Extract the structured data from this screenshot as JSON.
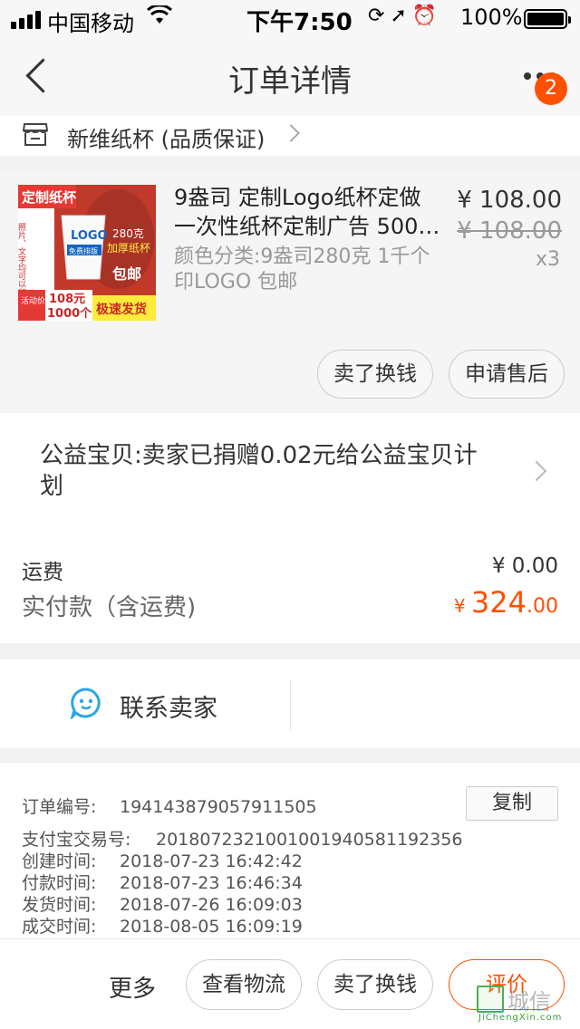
{
  "status_bar": {
    "carrier": "中国移动",
    "time": "下午7:50",
    "battery": "100%"
  },
  "nav": {
    "title": "订单详情",
    "badge": "2"
  },
  "shop": {
    "name": "新维纸杯 (品质保证)"
  },
  "product": {
    "title": "9盎司  定制Logo纸杯定做一次性纸杯定制广告 500…",
    "sku": "颜色分类:9盎司280克 1千个  印LOGO 包邮",
    "price": "¥ 108.00",
    "original_price": "¥ 108.00",
    "quantity": "x3",
    "thumb": {
      "top_label": "定制纸杯",
      "side_label": "照片、文字均可以印无颜色限制",
      "cup_logo": "LOGO",
      "cup_sub": "免费排版",
      "weight": "280克",
      "thick": "加厚纸杯",
      "free_ship": "包邮",
      "promo_tag": "活动价",
      "promo_price": "108元",
      "promo_qty": "1000个",
      "fast_ship": "极速发货"
    },
    "actions": [
      {
        "label": "卖了换钱"
      },
      {
        "label": "申请售后"
      }
    ]
  },
  "charity": {
    "text": "公益宝贝:卖家已捐赠0.02元给公益宝贝计划"
  },
  "payment": {
    "shipping_label": "运费",
    "shipping_value": "¥ 0.00",
    "paid_label": "实付款（含运费)",
    "paid_currency": "¥ ",
    "paid_int": "324",
    "paid_dec": ".00"
  },
  "contact": {
    "label": "联系卖家"
  },
  "order_info": {
    "copy_label": "复制",
    "rows": [
      {
        "key": "订单编号:",
        "value": "194143879057911505"
      },
      {
        "key": "支付宝交易号:",
        "value": "2018072321001001940581192356"
      },
      {
        "key": "创建时间:",
        "value": "2018-07-23 16:42:42"
      },
      {
        "key": "付款时间:",
        "value": "2018-07-23 16:46:34"
      },
      {
        "key": "发货时间:",
        "value": "2018-07-26 16:09:03"
      },
      {
        "key": "成交时间:",
        "value": "2018-08-05 16:09:19"
      }
    ]
  },
  "footer": {
    "more": "更多",
    "buttons": [
      {
        "label": "查看物流"
      },
      {
        "label": "卖了换钱"
      },
      {
        "label": "评价"
      }
    ]
  },
  "watermark": {
    "cn": "城信",
    "en": "JiChengXin.com"
  },
  "colors": {
    "accent": "#ff5000",
    "page_bg": "#f2f2f2",
    "contact_icon": "#2aa6e8"
  },
  "icons": {
    "back": "chevron-left-icon",
    "more": "ellipsis-icon",
    "shop": "shop-icon",
    "contact": "chat-smile-icon"
  }
}
